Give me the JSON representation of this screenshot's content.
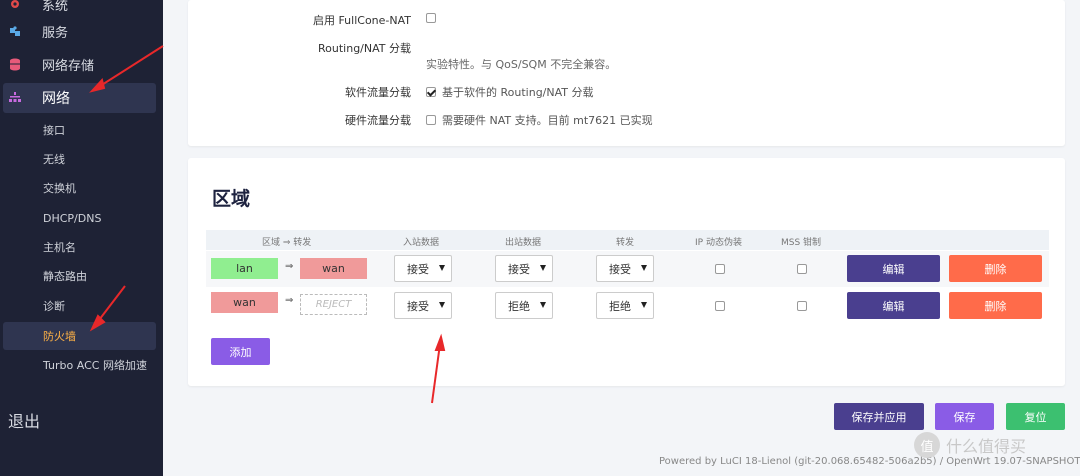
{
  "sidebar": {
    "top_items": [
      {
        "label": "系统",
        "icon": "gear-icon"
      },
      {
        "label": "服务",
        "icon": "puzzle-icon"
      },
      {
        "label": "网络存储",
        "icon": "database-icon"
      },
      {
        "label": "网络",
        "icon": "sitemap-icon"
      }
    ],
    "sub_items": [
      "接口",
      "无线",
      "交换机",
      "DHCP/DNS",
      "主机名",
      "静态路由",
      "诊断",
      "防火墙",
      "Turbo ACC 网络加速"
    ],
    "logout": "退出"
  },
  "settings": {
    "fullcone_label": "启用 FullCone-NAT",
    "routing_label": "Routing/NAT 分载",
    "routing_desc": "实验特性。与 QoS/SQM 不完全兼容。",
    "sw_label": "软件流量分载",
    "sw_text": "基于软件的 Routing/NAT 分载",
    "hw_label": "硬件流量分载",
    "hw_text": "需要硬件 NAT 支持。目前 mt7621 已实现"
  },
  "zones": {
    "title": "区域",
    "headers": {
      "zone": "区域 ⇒ 转发",
      "input": "入站数据",
      "output": "出站数据",
      "forward": "转发",
      "masq": "IP 动态伪装",
      "mss": "MSS 钳制"
    },
    "rows": [
      {
        "zone": "lan",
        "arrow": "⇒",
        "dest": "wan",
        "input": "接受",
        "output": "接受",
        "forward": "接受",
        "edit": "编辑",
        "delete": "删除"
      },
      {
        "zone": "wan",
        "arrow": "⇒",
        "dest": "REJECT",
        "input": "接受",
        "output": "拒绝",
        "forward": "拒绝",
        "edit": "编辑",
        "delete": "删除"
      }
    ],
    "add": "添加"
  },
  "actions": {
    "save_apply": "保存并应用",
    "save": "保存",
    "reset": "复位"
  },
  "footer": "Powered by LuCI 18-Lienol (git-20.068.65482-506a2b5) / OpenWrt 19.07-SNAPSHOT",
  "watermark": {
    "badge": "值",
    "text": "什么值得买"
  },
  "colors": {
    "sidebar_bg": "#1e2235",
    "active_sub": "#ffb246",
    "edit": "#4a3f8f",
    "delete": "#ff6b4a",
    "add": "#8a5ce6",
    "reset": "#3cc070"
  }
}
